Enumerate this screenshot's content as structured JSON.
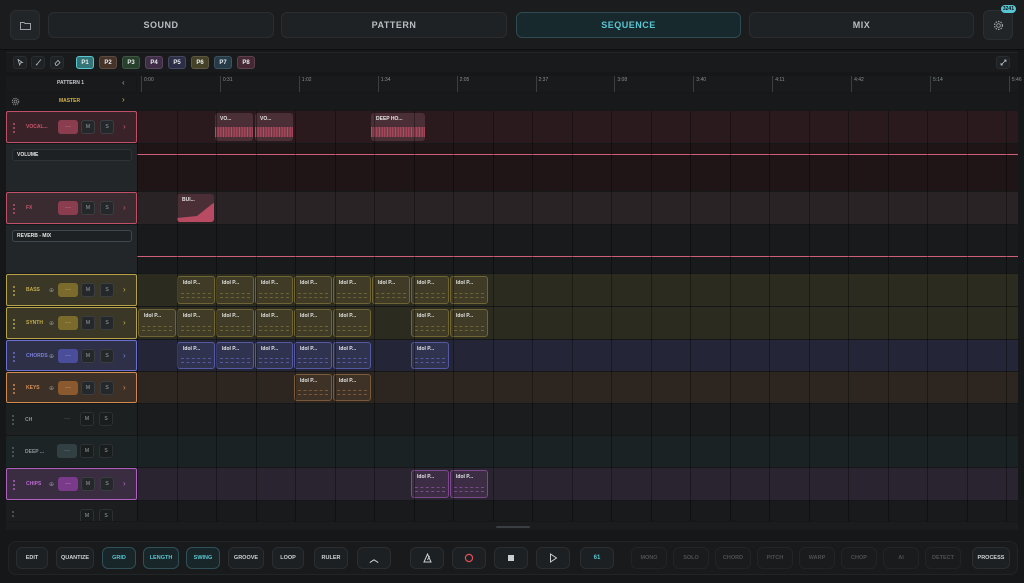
{
  "topnav": {
    "tabs": [
      {
        "label": "SOUND",
        "active": false
      },
      {
        "label": "PATTERN",
        "active": false
      },
      {
        "label": "SEQUENCE",
        "active": true
      },
      {
        "label": "MIX",
        "active": false
      }
    ],
    "settings_badge": "3241",
    "accent": "#59c6d3"
  },
  "tools": {
    "items": [
      "pointer-tool",
      "brush-tool",
      "eraser-tool"
    ],
    "patterns": [
      {
        "label": "P1",
        "color": "#3b8c8f"
      },
      {
        "label": "P2",
        "color": "#8a5a3a"
      },
      {
        "label": "P3",
        "color": "#3f7a46"
      },
      {
        "label": "P4",
        "color": "#7a4a8a"
      },
      {
        "label": "P5",
        "color": "#4a4e8a"
      },
      {
        "label": "P6",
        "color": "#8a7d3a"
      },
      {
        "label": "P7",
        "color": "#3a6e8a"
      },
      {
        "label": "P8",
        "color": "#8a3f5a"
      }
    ]
  },
  "ruler": {
    "pattern_label": "PATTERN 1",
    "ticks": [
      "0:00",
      "0:31",
      "1:02",
      "1:34",
      "2:05",
      "2:37",
      "3:08",
      "3:40",
      "4:11",
      "4:42",
      "5:14",
      "5:46"
    ]
  },
  "master": {
    "label": "MASTER"
  },
  "tracks": {
    "vocal": {
      "name": "VOCAL...",
      "m": "M",
      "s": "S",
      "color": "#c0506a",
      "clips": [
        "VO...",
        "VO...",
        "DEEP HO..."
      ]
    },
    "volume": {
      "label": "VOLUME"
    },
    "fx": {
      "name": "FX",
      "m": "M",
      "s": "S",
      "color": "#c0506a",
      "clips": [
        "BUI..."
      ]
    },
    "reverb": {
      "label": "REVERB - MIX"
    },
    "bass": {
      "name": "BASS",
      "m": "M",
      "s": "S",
      "color": "#b6a247",
      "clips": [
        "Idol P...",
        "Idol P...",
        "Idol P...",
        "Idol P...",
        "Idol P...",
        "Idol P...",
        "Idol P...",
        "Idol P..."
      ]
    },
    "synth": {
      "name": "SYNTH",
      "m": "M",
      "s": "S",
      "color": "#b6a247",
      "clips": [
        "Idol P...",
        "Idol P...",
        "Idol P...",
        "Idol P...",
        "Idol P...",
        "Idol P...",
        "Idol P...",
        "Idol P..."
      ]
    },
    "chords": {
      "name": "CHORDS",
      "m": "M",
      "s": "S",
      "color": "#6a6fd0",
      "clips": [
        "Idol P...",
        "Idol P...",
        "Idol P...",
        "Idol P...",
        "Idol P...",
        "Idol P..."
      ]
    },
    "keys": {
      "name": "KEYS",
      "m": "M",
      "s": "S",
      "color": "#d08a50",
      "clips": [
        "Idol P...",
        "Idol P..."
      ]
    },
    "ch": {
      "name": "CH",
      "m": "M",
      "s": "S"
    },
    "deep": {
      "name": "DEEP ...",
      "m": "M",
      "s": "S"
    },
    "chips": {
      "name": "CHIPS",
      "m": "M",
      "s": "S",
      "color": "#b060c0",
      "clips": [
        "Idol P...",
        "Idol P..."
      ]
    },
    "partial": {
      "name": "HH",
      "m": "M",
      "s": "S"
    }
  },
  "bottom": {
    "left": [
      {
        "label": "EDIT",
        "on": false
      },
      {
        "label": "QUANTIZE",
        "on": false
      },
      {
        "label": "GRID",
        "on": true
      },
      {
        "label": "LENGTH",
        "on": true
      },
      {
        "label": "SWING",
        "on": true
      },
      {
        "label": "GROOVE",
        "on": false
      },
      {
        "label": "LOOP",
        "on": false
      },
      {
        "label": "RULER",
        "on": false
      }
    ],
    "bpm": "61",
    "right": [
      "MONO",
      "SOLO",
      "CHORD",
      "PITCH",
      "WARP",
      "CHOP",
      "AI",
      "DETECT"
    ],
    "process": "PROCESS"
  }
}
